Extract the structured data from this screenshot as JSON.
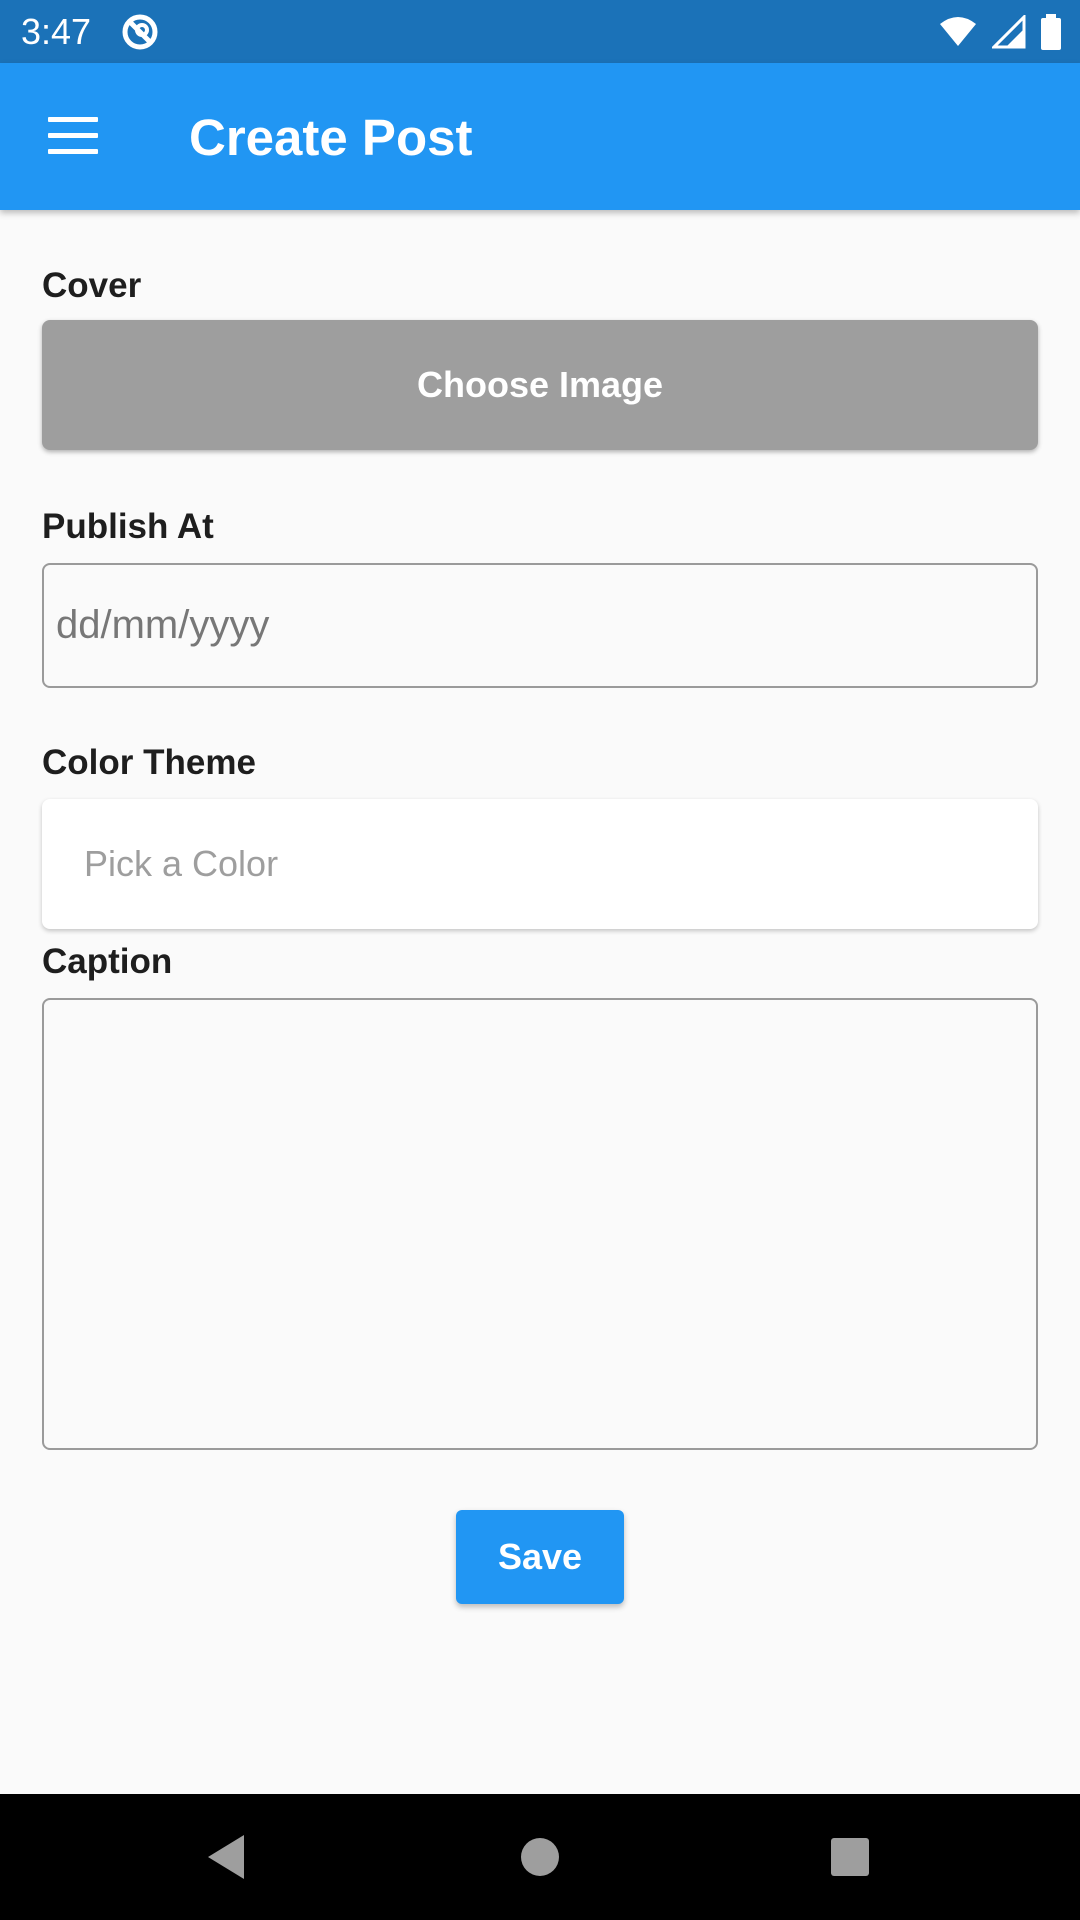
{
  "status_bar": {
    "time": "3:47",
    "icons": [
      "app-notification-icon",
      "wifi-icon",
      "cell-signal-icon",
      "battery-icon"
    ]
  },
  "app_bar": {
    "title": "Create Post",
    "menu_icon": "menu-icon",
    "background_color": "#2196f3"
  },
  "form": {
    "cover": {
      "label": "Cover",
      "button_label": "Choose Image"
    },
    "publish_at": {
      "label": "Publish At",
      "placeholder": "dd/mm/yyyy",
      "value": ""
    },
    "color_theme": {
      "label": "Color Theme",
      "placeholder": "Pick a Color"
    },
    "caption": {
      "label": "Caption",
      "value": ""
    },
    "save_label": "Save"
  },
  "nav_bar": {
    "buttons": [
      "back-icon",
      "home-icon",
      "recents-icon"
    ]
  },
  "colors": {
    "primary": "#2196f3",
    "status_bar": "#1b72b8",
    "choose_image_button": "#9e9e9e",
    "background": "#fafafa"
  }
}
